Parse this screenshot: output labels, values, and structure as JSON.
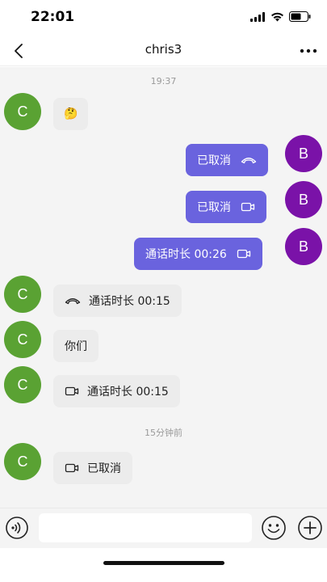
{
  "status_bar": {
    "time": "22:01"
  },
  "header": {
    "title": "chris3"
  },
  "messages": [
    {
      "type": "time",
      "text": "19:37"
    },
    {
      "type": "in",
      "avatar": "C",
      "text": "🤔",
      "icon": ""
    },
    {
      "type": "out",
      "avatar": "B",
      "text": "已取消",
      "icon": "phone-hangup-icon"
    },
    {
      "type": "out",
      "avatar": "B",
      "text": "已取消",
      "icon": "video-camera-icon"
    },
    {
      "type": "out",
      "avatar": "B",
      "text": "通话时长 00:26",
      "icon": "video-camera-icon"
    },
    {
      "type": "in",
      "avatar": "C",
      "text": "通话时长 00:15",
      "icon": "phone-hangup-icon"
    },
    {
      "type": "in",
      "avatar": "C",
      "text": "你们",
      "icon": ""
    },
    {
      "type": "in",
      "avatar": "C",
      "text": "通话时长 00:15",
      "icon": "video-camera-icon"
    },
    {
      "type": "time",
      "text": "15分钟前"
    },
    {
      "type": "in",
      "avatar": "C",
      "text": "已取消",
      "icon": "video-camera-icon"
    }
  ],
  "input_bar": {
    "placeholder": ""
  },
  "colors": {
    "incoming_avatar": "#5aa233",
    "outgoing_avatar": "#7a12a8",
    "outgoing_bubble": "#6a63de",
    "incoming_bubble": "#ececec"
  }
}
